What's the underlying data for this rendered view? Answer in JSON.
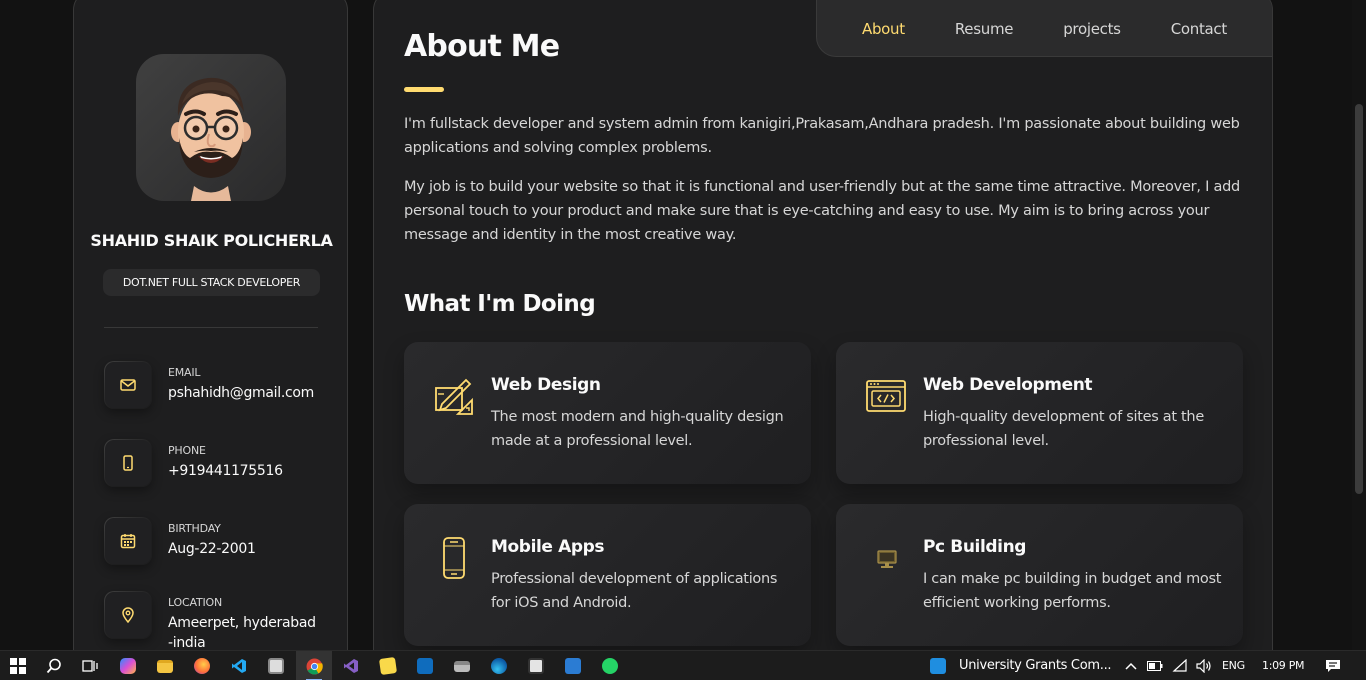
{
  "profile": {
    "name": "SHAHID SHAIK POLICHERLA",
    "title": "DOT.NET FULL STACK DEVELOPER"
  },
  "contacts": [
    {
      "label": "EMAIL",
      "value": "pshahidh@gmail.com",
      "icon": "mail-icon"
    },
    {
      "label": "PHONE",
      "value": "+919441175516",
      "icon": "phone-icon"
    },
    {
      "label": "BIRTHDAY",
      "value": "Aug-22-2001",
      "icon": "calendar-icon"
    },
    {
      "label": "LOCATION",
      "value": "Ameerpet, hyderabad -india",
      "icon": "location-icon"
    }
  ],
  "nav": {
    "items": [
      "About",
      "Resume",
      "projects",
      "Contact"
    ],
    "active": "About"
  },
  "about": {
    "heading": "About Me",
    "paragraphs": [
      "I'm fullstack developer and system admin from kanigiri,Prakasam,Andhara pradesh. I'm passionate about building web applications and solving complex problems.",
      "My job is to build your website so that it is functional and user-friendly but at the same time attractive. Moreover, I add personal touch to your product and make sure that is eye-catching and easy to use. My aim is to bring across your message and identity in the most creative way."
    ]
  },
  "services": {
    "heading": "What I'm Doing",
    "items": [
      {
        "title": "Web Design",
        "text": "The most modern and high-quality design made at a professional level.",
        "icon": "design-tools-icon"
      },
      {
        "title": "Web Development",
        "text": "High-quality development of sites at the professional level.",
        "icon": "code-window-icon"
      },
      {
        "title": "Mobile Apps",
        "text": "Professional development of applications for iOS and Android.",
        "icon": "mobile-icon"
      },
      {
        "title": "Pc Building",
        "text": "I can make pc building in budget and most efficient working performs.",
        "icon": "monitor-icon"
      }
    ]
  },
  "colors": {
    "accent": "#ffdb70",
    "background": "#121212",
    "card": "#1e1e1f"
  },
  "taskbar": {
    "news": "University Grants Com...",
    "language": "ENG",
    "time": "1:09 PM"
  }
}
